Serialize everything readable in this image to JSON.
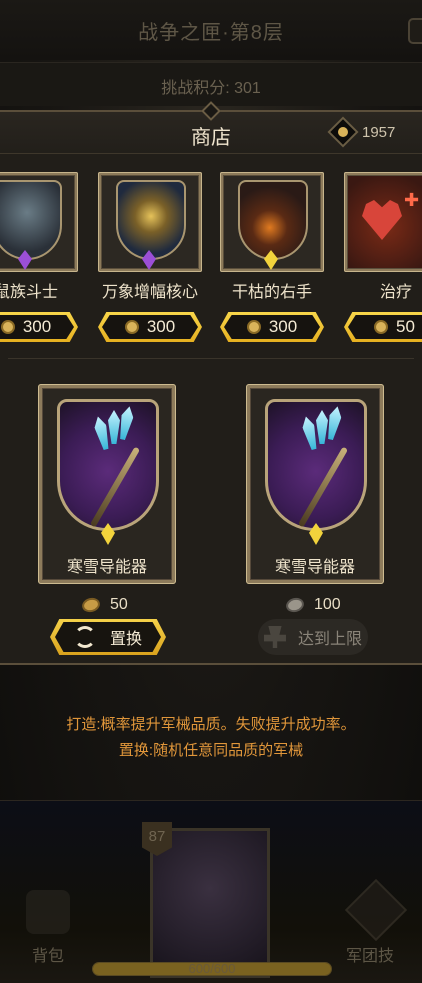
{
  "header": {
    "title": "战争之匣·第8层",
    "score_text": "挑战积分: 301"
  },
  "shop": {
    "title": "商店",
    "currency": "1957",
    "items": [
      {
        "name": "鼠族斗士",
        "price": "300",
        "gem_color": "#9b4fd6",
        "art": "rat-warrior"
      },
      {
        "name": "万象增幅核心",
        "price": "300",
        "gem_color": "#9b4fd6",
        "art": "armillary-core"
      },
      {
        "name": "干枯的右手",
        "price": "300",
        "gem_color": "#f2d33c",
        "art": "withered-hand"
      },
      {
        "name": "治疗",
        "price": "50",
        "gem_color": null,
        "art": "heal-heart"
      }
    ]
  },
  "forge": {
    "cards": [
      {
        "name": "寒雪导能器",
        "cost": "50",
        "coin": "gold",
        "action": "置换",
        "action_enabled": true
      },
      {
        "name": "寒雪导能器",
        "cost": "100",
        "coin": "grey",
        "action": "达到上限",
        "action_enabled": false
      }
    ]
  },
  "info": {
    "line1": "打造:概率提升军械品质。失败提升成功率。",
    "line2": "置换:随机任意同品质的军械"
  },
  "bottom": {
    "level": "87",
    "bag_label": "背包",
    "skill_label": "军团技",
    "hp_text": "600/600",
    "hp_fraction": 1.0
  },
  "colors": {
    "accent_gold": "#f2c93a",
    "info_orange": "#e0963a",
    "panel": "#211e19"
  }
}
